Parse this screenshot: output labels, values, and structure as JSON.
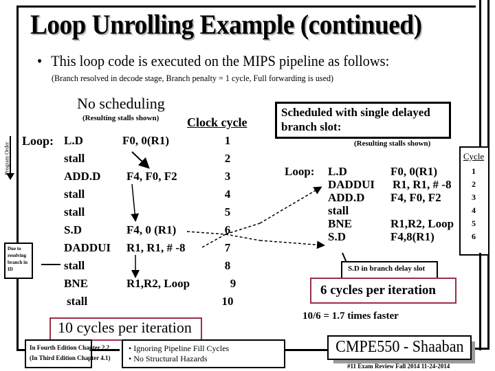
{
  "slide": {
    "title": "Loop Unrolling Example (continued)",
    "bullet": "This loop code is executed on the MIPS pipeline as follows:",
    "bullet_marker": "•",
    "subnote": "(Branch resolved in decode stage,  Branch penalty = 1 cycle,  Full forwarding is used)"
  },
  "left_panel": {
    "heading": "No scheduling",
    "stalls_note": "(Resulting stalls shown)",
    "clock_header": "Clock cycle",
    "loop_label": "Loop:",
    "program_order_label": "Program Order",
    "due_note": "Due to resolving branch in ID",
    "rows": [
      {
        "op": "L.D",
        "args": "F0, 0(R1)",
        "cycle": "1"
      },
      {
        "op": "stall",
        "args": "",
        "cycle": "2"
      },
      {
        "op": "ADD.D",
        "args": "F4, F0, F2",
        "cycle": "3"
      },
      {
        "op": "stall",
        "args": "",
        "cycle": "4"
      },
      {
        "op": "stall",
        "args": "",
        "cycle": "5"
      },
      {
        "op": "S.D",
        "args": "F4, 0 (R1)",
        "cycle": "6"
      },
      {
        "op": "DADDUI",
        "args": "R1, R1, # -8",
        "cycle": "7"
      },
      {
        "op": "stall",
        "args": "",
        "cycle": "8"
      },
      {
        "op": "BNE",
        "args": "R1,R2, Loop",
        "cycle": "9"
      },
      {
        "op": "stall",
        "args": "",
        "cycle": "10"
      }
    ],
    "summary": "10 cycles per iteration"
  },
  "right_panel": {
    "heading_line1": "Scheduled with single delayed",
    "heading_line2": "branch slot:",
    "stalls_note": "(Resulting stalls shown)",
    "cycle_header": "Cycle",
    "loop_label": "Loop:",
    "rows": [
      {
        "op": "L.D",
        "args": "F0, 0(R1)",
        "cycle": "1"
      },
      {
        "op": "DADDUI",
        "args": "R1, R1, # -8",
        "cycle": "2"
      },
      {
        "op": "ADD.D",
        "args": "F4, F0, F2",
        "cycle": "3"
      },
      {
        "op": "stall",
        "args": "",
        "cycle": "4"
      },
      {
        "op": "BNE",
        "args": "R1,R2, Loop",
        "cycle": "5"
      },
      {
        "op": "S.D",
        "args": "F4,8(R1)",
        "cycle": "6"
      }
    ],
    "delay_slot_note": "S.D in branch delay slot",
    "summary": "6 cycles per iteration",
    "speedup": "10/6  =  1.7  times faster"
  },
  "footer": {
    "edition_line1": "In Fourth Edition Chapter 2.2",
    "edition_line2": "(In Third Edition Chapter 4.1)",
    "assumption1": "Ignoring Pipeline Fill Cycles",
    "assumption2": "No Structural Hazards",
    "brand": "CMPE550 - Shaaban",
    "slide_ref": "#11   Exam Review   Fall 2014   11-24-2014"
  },
  "colors": {
    "summary_border": "#9b2d46",
    "title_shadow": "#b9b9b9",
    "brand_shadow": "#9a9a9a"
  }
}
